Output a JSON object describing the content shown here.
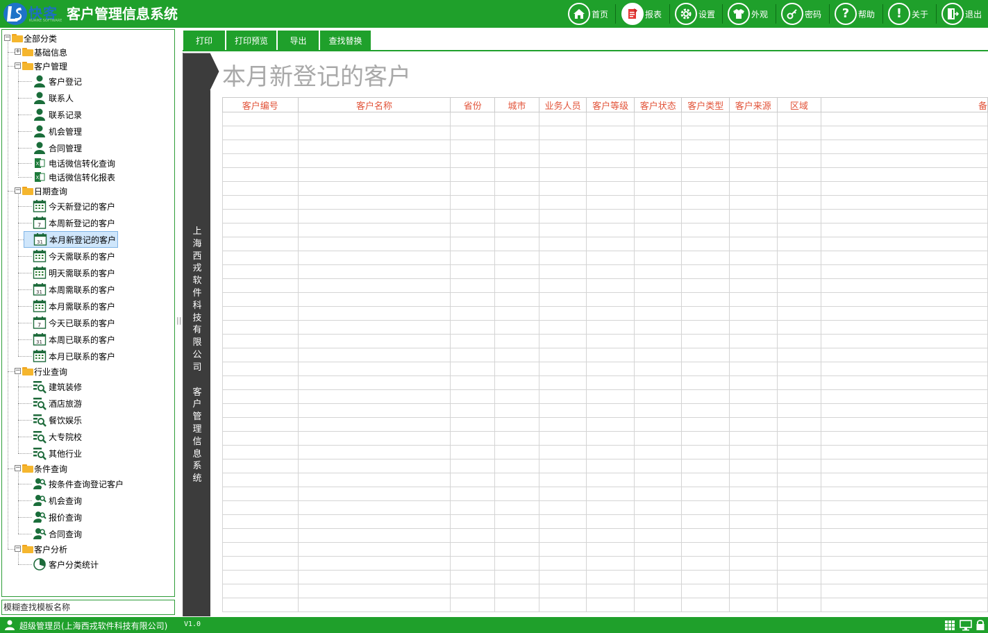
{
  "app": {
    "logo_text": "快客",
    "logo_sub": "KUAIKE SOFTWARE",
    "title": "客户管理信息系统"
  },
  "toolbar": {
    "items": [
      {
        "label": "首页",
        "icon": "home-icon"
      },
      {
        "label": "报表",
        "icon": "report-icon"
      },
      {
        "label": "设置",
        "icon": "gear-icon"
      },
      {
        "label": "外观",
        "icon": "shirt-icon"
      },
      {
        "label": "密码",
        "icon": "key-icon"
      },
      {
        "label": "帮助",
        "icon": "help-icon"
      },
      {
        "label": "关于",
        "icon": "info-icon"
      },
      {
        "label": "退出",
        "icon": "exit-icon"
      }
    ]
  },
  "tree": {
    "root": "全部分类",
    "groups": [
      {
        "label": "基础信息",
        "children": []
      },
      {
        "label": "客户管理",
        "children": [
          "客户登记",
          "联系人",
          "联系记录",
          "机会管理",
          "合同管理",
          "电话微信转化查询",
          "电话微信转化报表"
        ]
      },
      {
        "label": "日期查询",
        "children": [
          "今天新登记的客户",
          "本周新登记的客户",
          "本月新登记的客户",
          "今天需联系的客户",
          "明天需联系的客户",
          "本周需联系的客户",
          "本月需联系的客户",
          "今天已联系的客户",
          "本周已联系的客户",
          "本月已联系的客户"
        ]
      },
      {
        "label": "行业查询",
        "children": [
          "建筑装修",
          "酒店旅游",
          "餐饮娱乐",
          "大专院校",
          "其他行业"
        ]
      },
      {
        "label": "条件查询",
        "children": [
          "按条件查询登记客户",
          "机会查询",
          "报价查询",
          "合同查询"
        ]
      },
      {
        "label": "客户分析",
        "children": [
          "客户分类统计"
        ]
      }
    ],
    "selected": "本月新登记的客户"
  },
  "search": {
    "placeholder": "模糊查找模板名称"
  },
  "actions": {
    "print": "打印",
    "print_preview": "打印预览",
    "export": "导出",
    "find_replace": "查找替换"
  },
  "report": {
    "title": "本月新登记的客户",
    "side_text_company": "上海西戎软件科技有限公司",
    "side_text_system": "客户管理信息系统",
    "columns": [
      "客户编号",
      "客户名称",
      "省份",
      "城市",
      "业务人员",
      "客户等级",
      "客户状态",
      "客户类型",
      "客户来源",
      "区域",
      "备"
    ]
  },
  "status": {
    "user": "超级管理员(上海西戎软件科技有限公司)",
    "version": "V1.0"
  },
  "colors": {
    "brand_green": "#1fa02b",
    "header_red": "#e2543a"
  }
}
